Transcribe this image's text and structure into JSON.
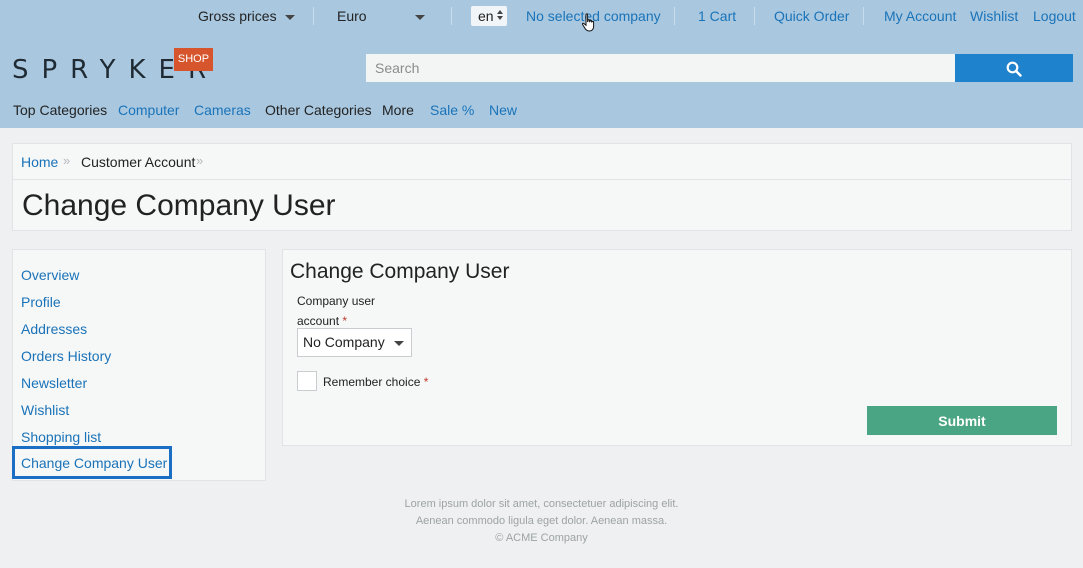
{
  "topbar": {
    "price_mode": "Gross prices",
    "currency": "Euro",
    "language": "en",
    "company": "No selected company",
    "cart": "1 Cart",
    "quick_order": "Quick Order",
    "my_account": "My Account",
    "wishlist": "Wishlist",
    "logout": "Logout"
  },
  "brand": {
    "logo": "SPRYKER",
    "badge": "SHOP",
    "badge_color": "#d6552c"
  },
  "search": {
    "placeholder": "Search",
    "button_icon": "search-icon"
  },
  "categories": [
    "Top Categories",
    "Computer",
    "Cameras",
    "Other Categories",
    "More",
    "Sale %",
    "New"
  ],
  "breadcrumb": {
    "home": "Home",
    "current": "Customer Account"
  },
  "page": {
    "title": "Change Company User"
  },
  "sidebar": {
    "items": [
      "Overview",
      "Profile",
      "Addresses",
      "Orders History",
      "Newsletter",
      "Wishlist",
      "Shopping list",
      "Change Company User"
    ],
    "active": "Change Company User"
  },
  "form": {
    "title": "Change Company User",
    "account_label_line1": "Company user",
    "account_label_line2": "account",
    "required_mark": "*",
    "select_value": "No Company",
    "remember_label": "Remember choice",
    "submit_label": "Submit",
    "submit_color": "#4aa585"
  },
  "footer": {
    "line1": "Lorem ipsum dolor sit amet, consectetuer adipiscing elit.",
    "line2": "Aenean commodo ligula eget dolor. Aenean massa.",
    "line3": "© ACME Company"
  }
}
